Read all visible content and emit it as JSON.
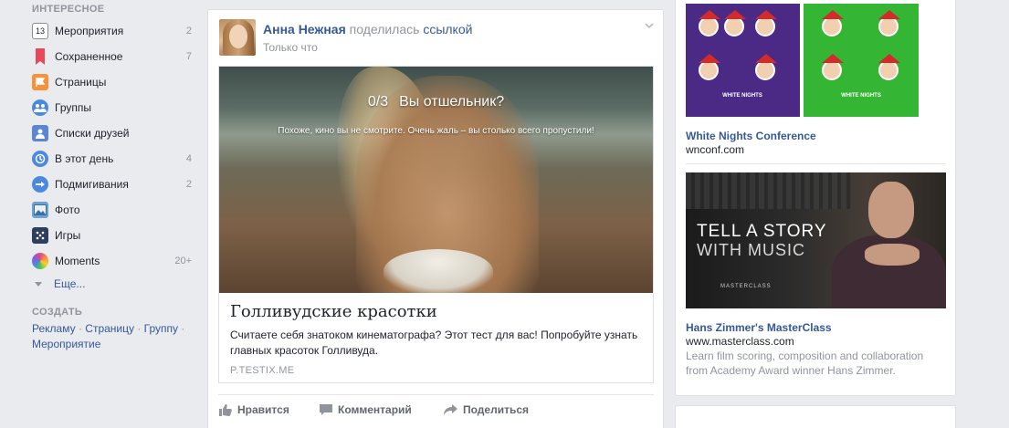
{
  "sidebar": {
    "interesting_title": "ИНТЕРЕСНОЕ",
    "items": [
      {
        "label": "Мероприятия",
        "count": "2",
        "icon": "calendar-icon",
        "color": "#ffffff"
      },
      {
        "label": "Сохраненное",
        "count": "7",
        "icon": "bookmark-icon",
        "color": "#e9475b"
      },
      {
        "label": "Страницы",
        "count": "",
        "icon": "flag-icon",
        "color": "#f7923b"
      },
      {
        "label": "Группы",
        "count": "",
        "icon": "groups-icon",
        "color": "#4b88e1"
      },
      {
        "label": "Списки друзей",
        "count": "",
        "icon": "friend-lists-icon",
        "color": "#5b86d6"
      },
      {
        "label": "В этот день",
        "count": "4",
        "icon": "on-this-day-icon",
        "color": "#4b88e1"
      },
      {
        "label": "Подмигивания",
        "count": "2",
        "icon": "poke-icon",
        "color": "#4b88e1"
      },
      {
        "label": "Фото",
        "count": "",
        "icon": "photo-icon",
        "color": "#6ba3d9"
      },
      {
        "label": "Игры",
        "count": "",
        "icon": "games-icon",
        "color": "#2d3f5f"
      },
      {
        "label": "Moments",
        "count": "20+",
        "icon": "moments-icon",
        "color": "#e04b8c"
      }
    ],
    "more_label": "Еще...",
    "create_title": "СОЗДАТЬ",
    "create_links": [
      "Рекламу",
      "Страницу",
      "Группу",
      "Мероприятие"
    ],
    "separator": " · "
  },
  "post": {
    "author": "Анна Нежная",
    "action": "поделилась",
    "object_link": "ссылкой",
    "timestamp": "Только что",
    "link": {
      "score": "0/3",
      "question": "Вы отшельник?",
      "subtitle": "Похоже, кино вы не смотрите.  Очень жаль – вы столько всего пропустили!",
      "title": "Голливудские красотки",
      "description": "Считаете себя знатоком кинематографа? Этот тест для вас! Попробуйте узнать главных красоток Голливуда.",
      "domain": "P.TESTIX.ME"
    },
    "actions": {
      "like": "Нравится",
      "comment": "Комментарий",
      "share": "Поделиться"
    }
  },
  "ads": [
    {
      "title": "White Nights Conference",
      "url": "wnconf.com",
      "badge": "WHITE NIGHTS",
      "brand_color_left": "#4b2a86",
      "brand_color_right": "#34b533"
    },
    {
      "title": "Hans Zimmer's MasterClass",
      "url": "www.masterclass.com",
      "description": "Learn film scoring, composition and collaboration from Academy Award winner Hans Zimmer.",
      "image_line1": "TELL A STORY",
      "image_line2": "WITH MUSIC",
      "image_logo": "MASTERCLASS"
    }
  ],
  "colors": {
    "link": "#365899",
    "muted": "#90949c",
    "background": "#e9ebee"
  }
}
